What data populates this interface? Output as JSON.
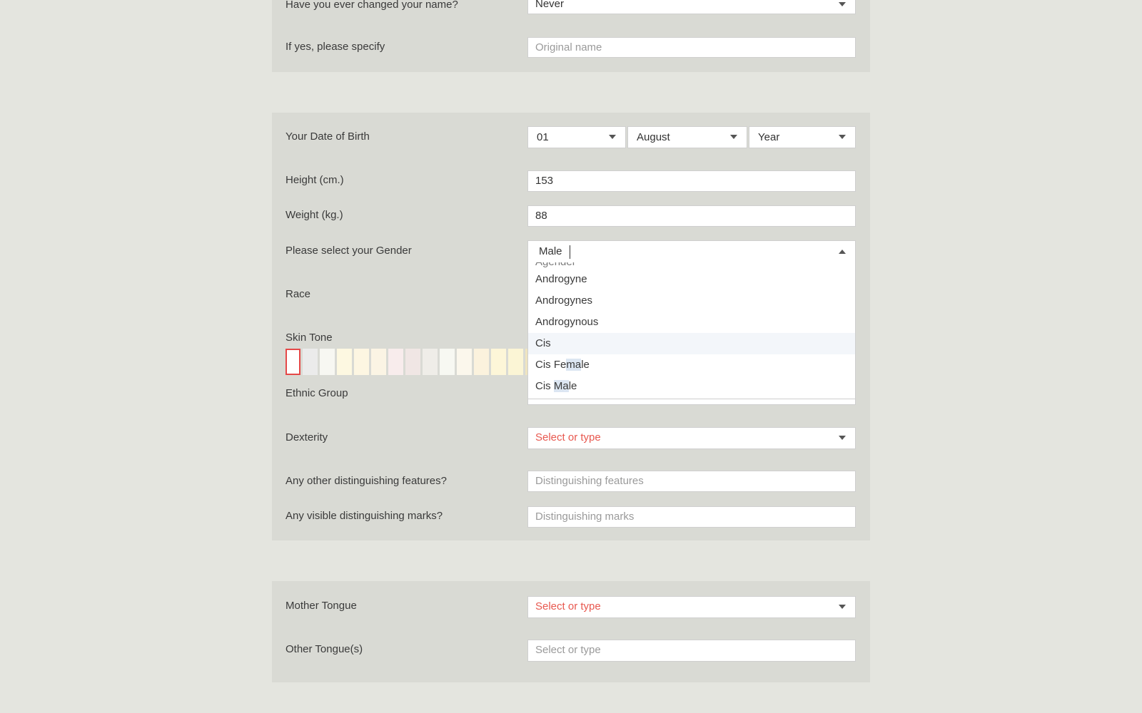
{
  "identity": {
    "name_changed": {
      "label": "Have you ever changed your name?",
      "value": "Never"
    },
    "original_name": {
      "label": "If yes, please specify",
      "placeholder": "Original name"
    }
  },
  "physical": {
    "dob": {
      "label": "Your Date of Birth",
      "day": "01",
      "month": "August",
      "year": "Year"
    },
    "height": {
      "label": "Height (cm.)",
      "value": "153"
    },
    "weight": {
      "label": "Weight (kg.)",
      "value": "88"
    },
    "gender": {
      "label": "Please select your Gender",
      "typed": "Male",
      "options": [
        "Agender",
        "Androgyne",
        "Androgynes",
        "Androgynous",
        "Cis",
        "Cis Female",
        "Cis Male"
      ],
      "highlighted_option": "Cis"
    },
    "race": {
      "label": "Race"
    },
    "skin_tone": {
      "label": "Skin Tone",
      "swatches": [
        "#ffffff",
        "#ebebeb",
        "#f7f7f2",
        "#fdf8e1",
        "#fdf6e2",
        "#fbf4e4",
        "#f8ecec",
        "#f0e6e4",
        "#efede8",
        "#f7f8f2",
        "#fbf7ec",
        "#fbf2dd",
        "#fdf6d8",
        "#fbf5d5",
        "#efe4bf",
        "#f7f0d4"
      ],
      "selected_index": 0
    },
    "ethnic_group": {
      "label": "Ethnic Group"
    },
    "dexterity": {
      "label": "Dexterity",
      "placeholder": "Select or type"
    },
    "features": {
      "label": "Any other distinguishing features?",
      "placeholder": "Distinguishing features"
    },
    "marks": {
      "label": "Any visible distinguishing marks?",
      "placeholder": "Distinguishing marks"
    }
  },
  "language": {
    "mother_tongue": {
      "label": "Mother Tongue",
      "placeholder": "Select or type"
    },
    "other_tongues": {
      "label": "Other Tongue(s)",
      "placeholder": "Select or type"
    }
  },
  "colors": {
    "page_bg": "#e4e5df",
    "card_bg": "#d9dad4",
    "required_placeholder": "#e8584f",
    "selected_swatch_border": "#e54848"
  }
}
